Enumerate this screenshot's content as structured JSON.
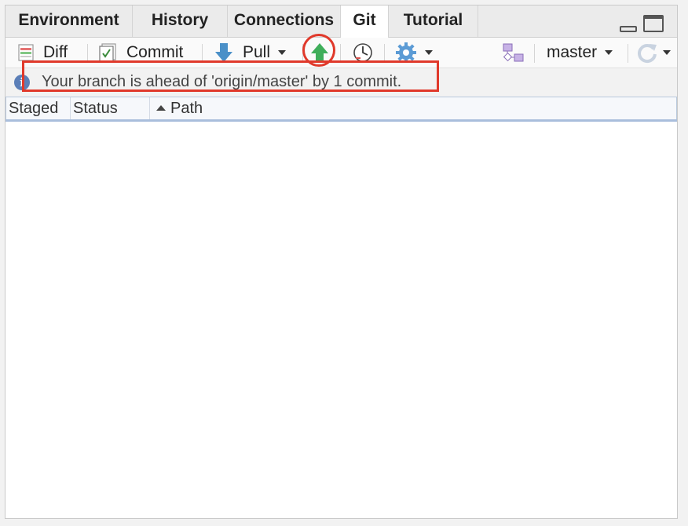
{
  "tabs": [
    {
      "label": "Environment",
      "active": false
    },
    {
      "label": "History",
      "active": false
    },
    {
      "label": "Connections",
      "active": false
    },
    {
      "label": "Git",
      "active": true
    },
    {
      "label": "Tutorial",
      "active": false
    }
  ],
  "toolbar": {
    "diff_label": "Diff",
    "commit_label": "Commit",
    "pull_label": "Pull",
    "branch_label": "master",
    "icons": [
      "diff-icon",
      "commit-icon",
      "pull-icon",
      "push-icon",
      "history-icon",
      "gear-icon",
      "branch-icon",
      "refresh-icon"
    ]
  },
  "info": {
    "message": "Your branch is ahead of 'origin/master' by 1 commit.",
    "icon_glyph": "i"
  },
  "table": {
    "columns": [
      "Staged",
      "Status",
      "Path"
    ],
    "sorted_column": "Path",
    "rows": []
  },
  "colors": {
    "highlight": "#e0392b",
    "push_green": "#3fae5a",
    "pull_blue": "#4a90c8",
    "info_blue": "#5b7fb8",
    "branch_purple": "#9b7fc9"
  }
}
